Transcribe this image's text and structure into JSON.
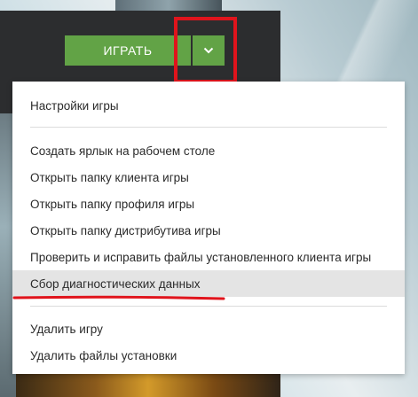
{
  "launcher": {
    "play_button_label": "ИГРАТЬ",
    "dropdown_icon": "chevron-down-icon",
    "accent_color": "#62a346",
    "highlight_color": "#e0141c"
  },
  "menu": {
    "items": [
      {
        "label": "Настройки игры"
      },
      {
        "label": "Создать ярлык на рабочем столе"
      },
      {
        "label": "Открыть папку клиента игры"
      },
      {
        "label": "Открыть папку профиля игры"
      },
      {
        "label": "Открыть папку дистрибутива игры"
      },
      {
        "label": "Проверить и исправить файлы установленного клиента игры"
      },
      {
        "label": "Сбор диагностических данных"
      },
      {
        "label": "Удалить игру"
      },
      {
        "label": "Удалить файлы установки"
      }
    ],
    "active_label": "Сбор диагностических данных"
  }
}
